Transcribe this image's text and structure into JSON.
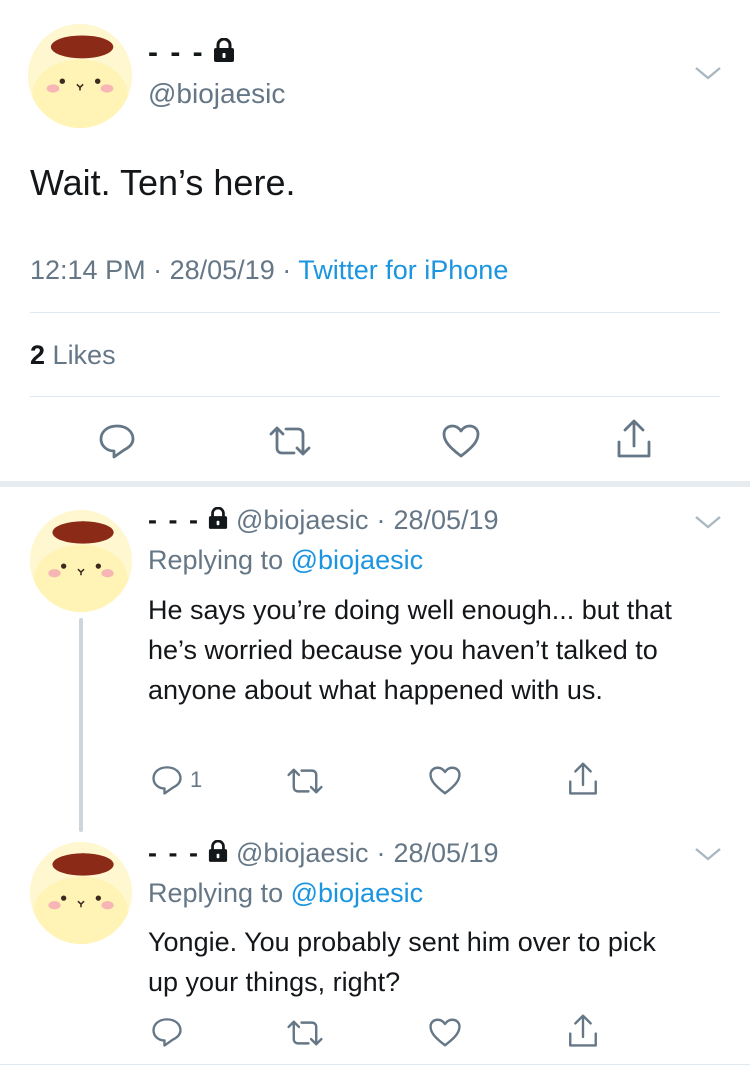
{
  "main_tweet": {
    "display_name": "- - -",
    "handle": "@biojaesic",
    "text": "Wait. Ten’s here.",
    "time": "12:14 PM",
    "date": "28/05/19",
    "source": "Twitter for iPhone",
    "sep": "·",
    "likes_count": "2",
    "likes_label": "Likes"
  },
  "replies": [
    {
      "display_name": "- - -",
      "handle": "@biojaesic",
      "date": "28/05/19",
      "sep": "·",
      "replying_to_label": "Replying to",
      "replying_to_handle": "@biojaesic",
      "text": "He says you’re doing well enough... but that he’s worried because you haven’t talked to anyone about what happened with us.",
      "reply_count": "1"
    },
    {
      "display_name": "- - -",
      "handle": "@biojaesic",
      "date": "28/05/19",
      "sep": "·",
      "replying_to_label": "Replying to",
      "replying_to_handle": "@biojaesic",
      "text": "Yongie. You probably sent him over to pick up your things, right?",
      "reply_count": ""
    }
  ],
  "colors": {
    "link": "#1b95e0",
    "secondary_text": "#657786",
    "primary_text": "#14171a",
    "divider": "#e1e8ed"
  },
  "icons": [
    "lock-icon",
    "chevron-down-icon",
    "reply-icon",
    "retweet-icon",
    "like-icon",
    "share-icon",
    "avatar"
  ]
}
